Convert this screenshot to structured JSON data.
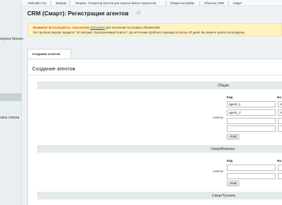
{
  "left_sidebar": {
    "items": [
      "апуска бизнес-",
      "ната списка"
    ]
  },
  "breadcrumbs": [
    "Рабочий стол",
    "Битрикс",
    "Битрикс. Генератор агентов для запуска бизнес-процессов",
    "Общие настройки",
    "Объекты CRM",
    "Смарт"
  ],
  "page": {
    "title": "CRM (Смарт): Регистрация агентов",
    "star_icon": "☆"
  },
  "notice": {
    "prefix": "Внимание! Воспользуйтесь технологией",
    "link": "SiteUpdate",
    "suffix": " для получения последних обновлений.",
    "line2_start": "Это пробная версия продукта \"1С-Битрикс: Корпоративный портал\". До истечения пробного периода осталось",
    "days": "17",
    "line2_end": "дней. Вы можете купить полнофункц"
  },
  "tab": {
    "label": "Создание агентов"
  },
  "form": {
    "title": "Создание агентов",
    "sections": {
      "general": {
        "title": "Общие",
        "row_label": "Агенты",
        "col_code": "Код",
        "col_name": "На",
        "codes": [
          "agent_1",
          "agent_2",
          "",
          ""
        ],
        "names": [
          "А",
          "А",
          "",
          ""
        ],
        "more_button": "+ЕЩЕ"
      },
      "funnel": {
        "title": "СмартВоронка",
        "row_label": "Агенты",
        "col_code": "Код",
        "col_name": "На",
        "codes": [
          "",
          ""
        ],
        "names": [
          "",
          ""
        ],
        "more_button": "+ЕЩЕ"
      },
      "tunnel": {
        "title": "СмартТуннель"
      }
    }
  },
  "colors": {
    "notice_bg": "#fff3c0",
    "notice_red": "#cc0000",
    "link_blue": "#1a56a5",
    "section_bg": "#e4e9ec"
  }
}
